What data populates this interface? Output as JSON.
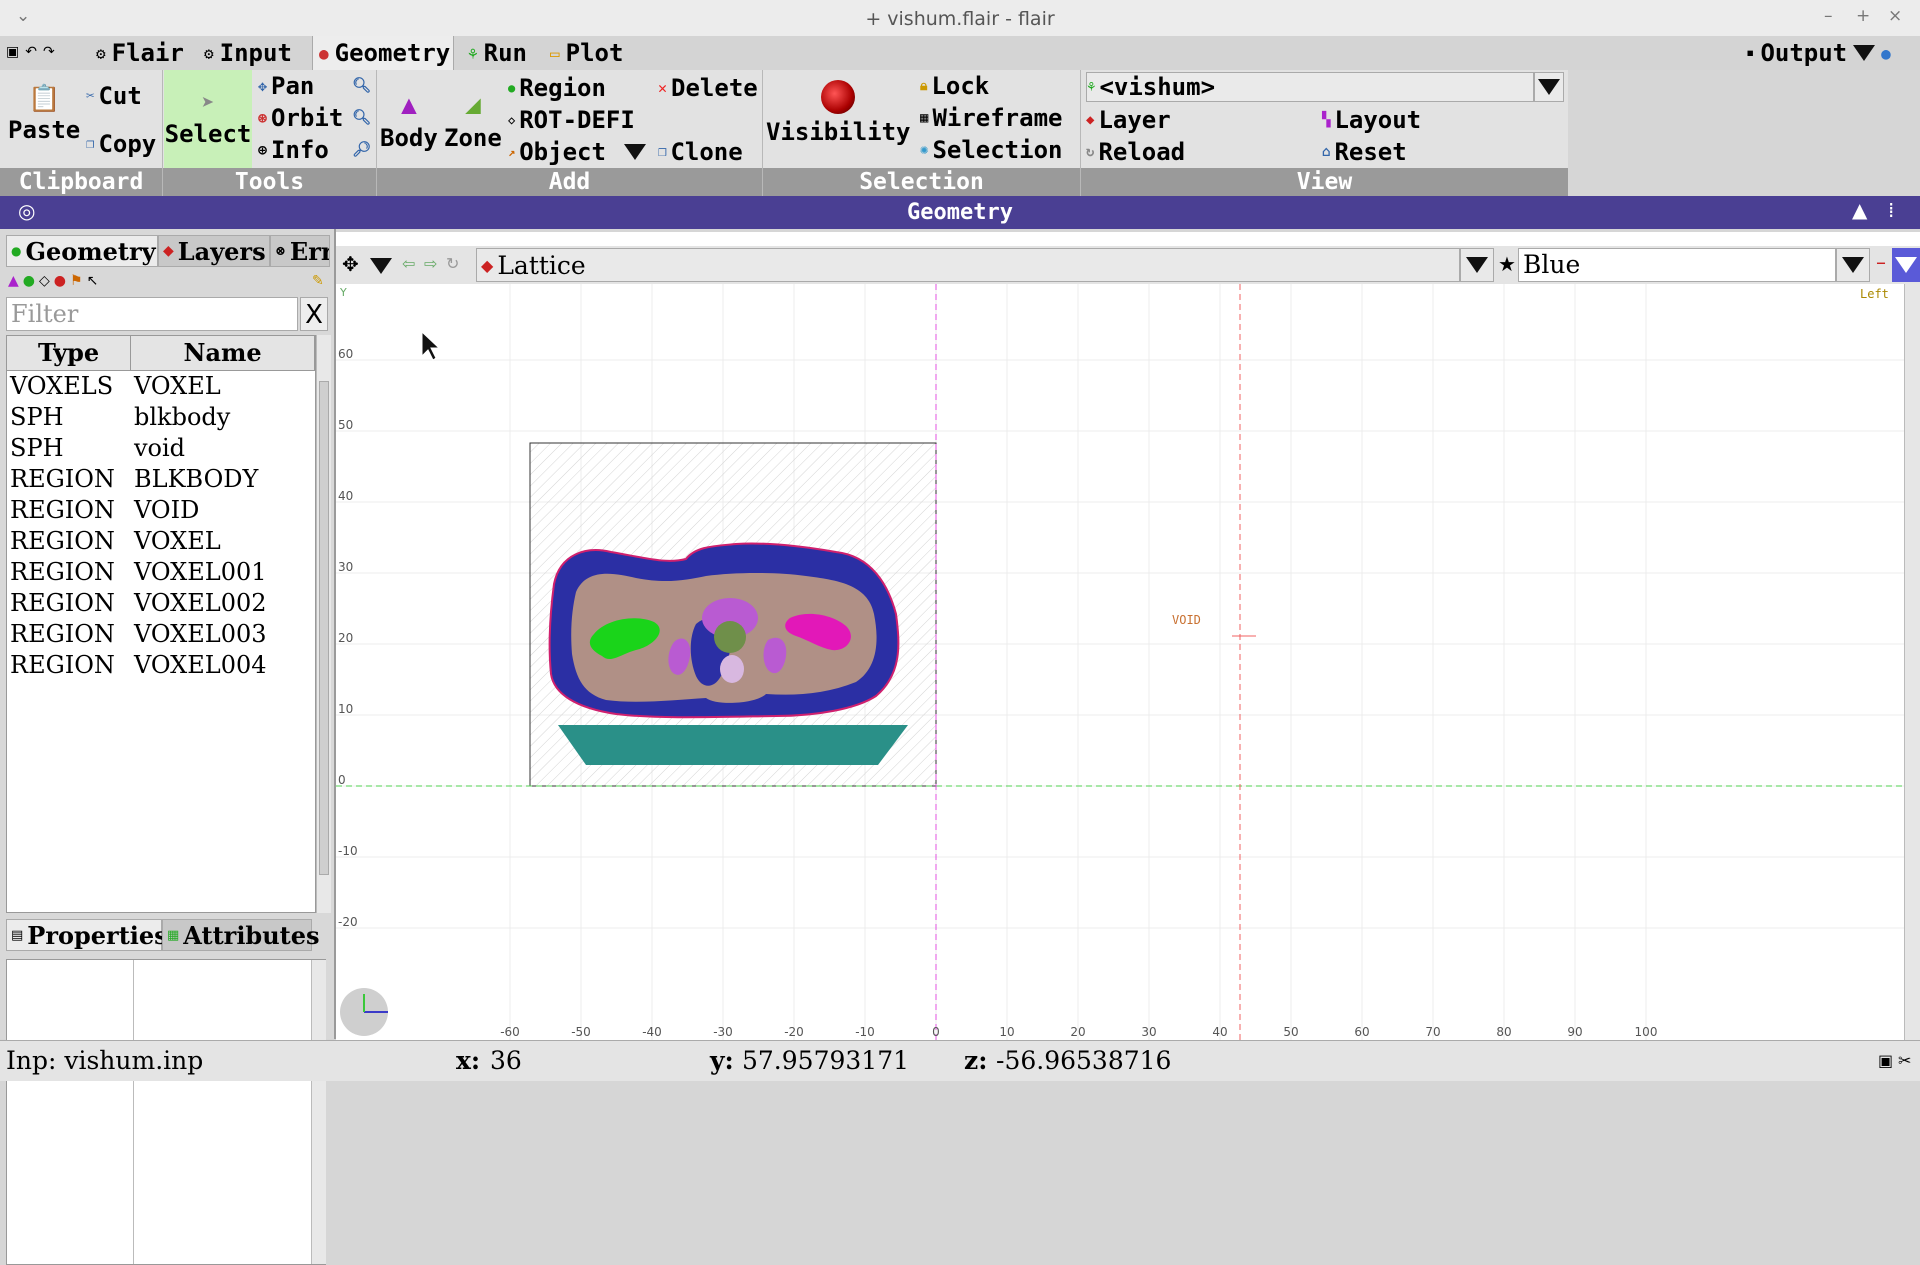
{
  "window": {
    "title": "+ vishum.flair - flair",
    "controls": {
      "minimize": "–",
      "maximize": "+",
      "close": "×"
    }
  },
  "menu": {
    "tabs": [
      "Flair",
      "Input",
      "Geometry",
      "Run",
      "Plot"
    ],
    "output_label": "Output"
  },
  "ribbon": {
    "clipboard": {
      "paste": "Paste",
      "cut": "Cut",
      "copy": "Copy",
      "label": "Clipboard"
    },
    "tools": {
      "select": "Select",
      "pan": "Pan",
      "orbit": "Orbit",
      "info": "Info",
      "label": "Tools"
    },
    "add": {
      "body": "Body",
      "zone": "Zone",
      "region": "Region",
      "rotdefi": "ROT-DEFI",
      "object": "Object",
      "delete": "Delete",
      "clone": "Clone",
      "label": "Add"
    },
    "selection": {
      "visibility": "Visibility",
      "lock": "Lock",
      "wireframe": "Wireframe",
      "selection": "Selection",
      "label": "Selection"
    },
    "view": {
      "project": "<vishum>",
      "layer": "Layer",
      "layout": "Layout",
      "reload": "Reload",
      "reset": "Reset",
      "label": "View"
    }
  },
  "geometry_header": {
    "title": "Geometry"
  },
  "left_panel": {
    "tabs": [
      "Geometry",
      "Layers",
      "Erro"
    ],
    "filter_placeholder": "Filter",
    "filter_clear": "X",
    "columns": [
      "Type",
      "Name"
    ],
    "rows": [
      [
        "VOXELS",
        "VOXEL"
      ],
      [
        "SPH",
        "blkbody"
      ],
      [
        "SPH",
        "void"
      ],
      [
        "REGION",
        "BLKBODY"
      ],
      [
        "REGION",
        "VOID"
      ],
      [
        "REGION",
        "VOXEL"
      ],
      [
        "REGION",
        "VOXEL001"
      ],
      [
        "REGION",
        "VOXEL002"
      ],
      [
        "REGION",
        "VOXEL003"
      ],
      [
        "REGION",
        "VOXEL004"
      ]
    ],
    "bottom_tabs": [
      "Properties",
      "Attributes"
    ]
  },
  "viewer": {
    "layer_value": "Lattice",
    "color_value": "Blue",
    "view_label": "Left",
    "y_axis_letter": "Y",
    "void_label": "VOID",
    "axes": {
      "x_ticks": [
        -60,
        -50,
        -40,
        -30,
        -20,
        -10,
        0,
        10,
        20,
        30,
        40,
        50,
        60,
        70,
        80,
        90,
        100
      ],
      "y_ticks": [
        60,
        50,
        40,
        30,
        20,
        10,
        0,
        -10,
        -20
      ]
    }
  },
  "status": {
    "input": "Inp: vishum.inp",
    "x_label": "x:",
    "x_value": "36",
    "y_label": "y:",
    "y_value": "57.95793171",
    "z_label": "z:",
    "z_value": "-56.96538716"
  },
  "colors": {
    "header": "#4a3f93",
    "select_active": "#c8f0b8",
    "body_blue": "#2b2fa4",
    "tissue": "#b09086",
    "green_organ": "#1ad41a",
    "magenta_organ": "#e218b8",
    "violet_organ": "#b95bd2",
    "teal_table": "#2a9088"
  }
}
